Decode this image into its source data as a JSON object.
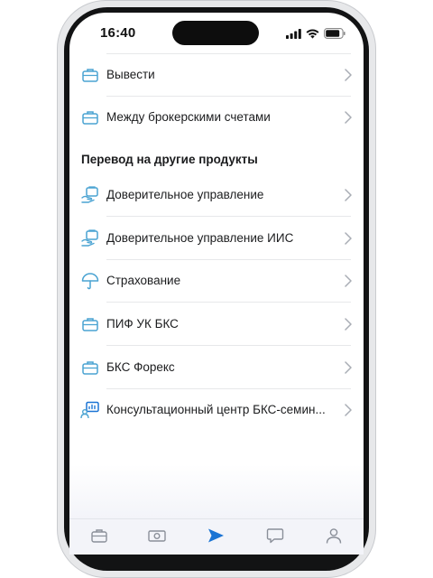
{
  "status_bar": {
    "time": "16:40"
  },
  "top_items": [
    {
      "label": "Вывести",
      "icon": "briefcase-icon"
    },
    {
      "label": "Между брокерскими счетами",
      "icon": "briefcase-icon"
    }
  ],
  "section": {
    "title": "Перевод на другие продукты"
  },
  "products": [
    {
      "label": "Доверительное управление",
      "icon": "trust-management-icon"
    },
    {
      "label": "Доверительное управление ИИС",
      "icon": "trust-management-icon"
    },
    {
      "label": "Страхование",
      "icon": "umbrella-icon"
    },
    {
      "label": "ПИФ УК БКС",
      "icon": "briefcase-icon"
    },
    {
      "label": "БКС Форекс",
      "icon": "briefcase-icon"
    },
    {
      "label": "Консультационный центр БКС-семин...",
      "icon": "presentation-icon"
    }
  ],
  "tab_bar": [
    {
      "name": "portfolio",
      "icon": "briefcase-icon",
      "active": false
    },
    {
      "name": "money",
      "icon": "banknote-icon",
      "active": false
    },
    {
      "name": "transfers",
      "icon": "send-icon",
      "active": true
    },
    {
      "name": "chat",
      "icon": "chat-icon",
      "active": false
    },
    {
      "name": "profile",
      "icon": "profile-icon",
      "active": false
    }
  ],
  "colors": {
    "accent": "#1b74d4",
    "icon": "#4aa3d2",
    "inactive_tab": "#8a8f99",
    "chevron": "#a9adb5"
  }
}
